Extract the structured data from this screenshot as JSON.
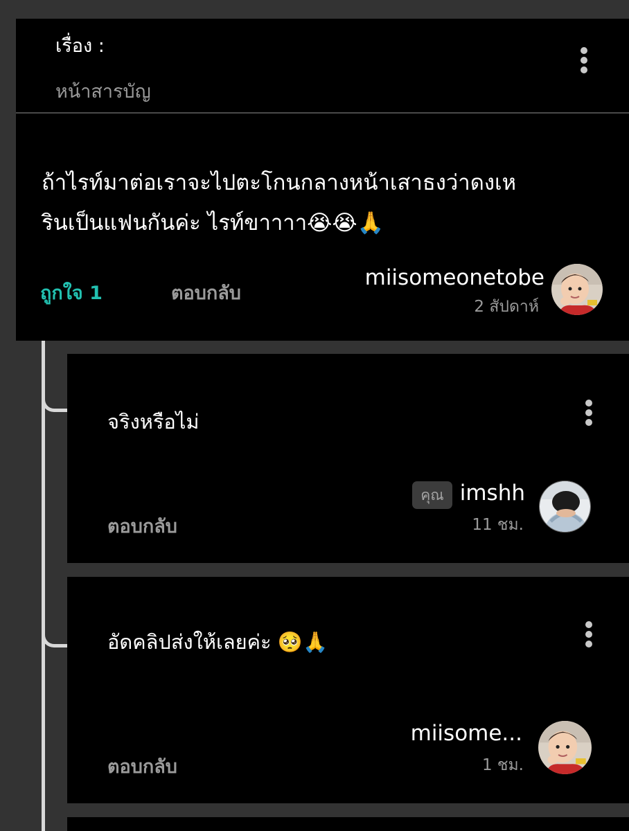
{
  "topic": {
    "label": "เรื่อง :",
    "value": "หน้าสารบัญ"
  },
  "main_comment": {
    "line1": "ถ้าไรท์มาต่อเราจะไปตะโกนกลางหน้าเสาธงว่าดงเห",
    "line2": "รินเป็นแฟนกันค่ะ ไรท์ขาาาา😭😭🙏",
    "like_label": "ถูกใจ 1",
    "reply_label": "ตอบกลับ",
    "author": "miisomeonetobe",
    "time": "2 สัปดาห์",
    "avatar_icon": "child-avatar-icon"
  },
  "replies": [
    {
      "text": "จริงหรือไม่",
      "you_badge": "คุณ",
      "author": "imshh",
      "time": "11 ชม.",
      "reply_label": "ตอบกลับ",
      "avatar_icon": "person-hiding-face-avatar-icon"
    },
    {
      "text": "อัดคลิปส่งให้เลยค่ะ 🥺🙏",
      "author": "miisome...",
      "time": "1 ชม.",
      "reply_label": "ตอบกลับ",
      "avatar_icon": "child-avatar-icon"
    }
  ],
  "colors": {
    "background": "#333333",
    "card": "#000000",
    "like_accent": "#22c0b0",
    "muted_text": "#9b9b9b"
  }
}
